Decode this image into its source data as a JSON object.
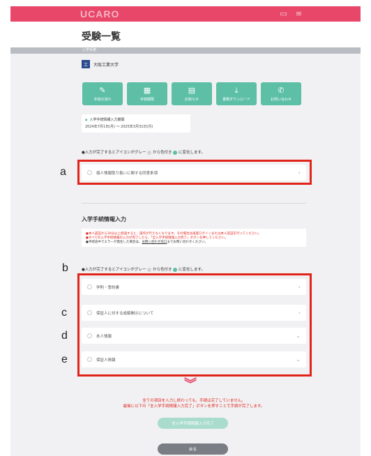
{
  "header": {
    "logo_text": "UCARO",
    "message_icon": "message-icon",
    "menu_icon": "menu-icon",
    "bg_color": "#e8476a"
  },
  "page_title": "受験一覧",
  "section_label": "入学手続",
  "university": {
    "logo_text": "工",
    "name": "大阪工業大学"
  },
  "tiles": [
    {
      "label": "手続の流れ",
      "icon": "pen-icon"
    },
    {
      "label": "手続期限",
      "icon": "calendar-icon"
    },
    {
      "label": "お知らせ",
      "icon": "chat-icon"
    },
    {
      "label": "書類ダウンロード",
      "icon": "download-icon"
    },
    {
      "label": "お問い合わせ",
      "icon": "phone-icon"
    }
  ],
  "period": {
    "title": "入学手続情報入力期間",
    "dates": "2024年7月1日(月) ～ 2025年3月31日(月)"
  },
  "notes": {
    "icon_change_a": "●入力が完了するとアイコンがグレー",
    "icon_change_b": "から色付き",
    "icon_change_c": "に変化します。"
  },
  "consent_row": {
    "letter": "a",
    "label": "個人情報取り扱いに関する同意条項"
  },
  "entry_section": {
    "title": "入学手続情報入力",
    "warn_line1": "●本人認証から30分以上経過すると、操作が行えなくなります。その場合は再度ログインまたは本人認証を行ってください。",
    "warn_line2": "●すべての入学手続情報の入力が完了したら、「全入学手続情報入力完了」ボタンを押してください。",
    "warn_line3_a": "●手続途中でエラーが発生した場合は、",
    "warn_line3_link": "お問い合わせ窓口",
    "warn_line3_b": "までお問い合わせください。"
  },
  "rows": [
    {
      "letter": "b",
      "label": "学則・誓約書",
      "chevron": "›"
    },
    {
      "letter": "c",
      "label": "保証人に対する成績開示について",
      "chevron": "›"
    },
    {
      "letter": "d",
      "label": "本人情報",
      "chevron": "⌄"
    },
    {
      "letter": "e",
      "label": "保証人情報",
      "chevron": "⌄"
    }
  ],
  "footer": {
    "arrow_icon": "double-chevron-down-icon",
    "message_line1": "全ての項目を入力し終わっても、手続は完了していません。",
    "message_line2": "最後に以下の「全入学手続情報入力完了」ボタンを押すことで手続が完了します。",
    "complete_button": "全入学手続情報入力完了",
    "back_button": "戻る"
  },
  "colors": {
    "accent": "#5cbfa6",
    "brand": "#e8476a",
    "highlight": "#e2231a"
  }
}
